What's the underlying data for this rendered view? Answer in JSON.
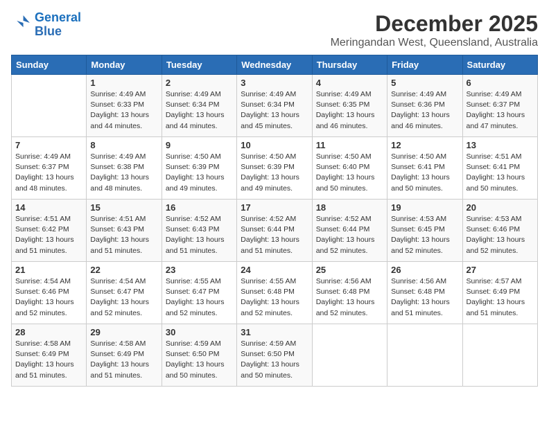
{
  "logo": {
    "line1": "General",
    "line2": "Blue"
  },
  "title": "December 2025",
  "location": "Meringandan West, Queensland, Australia",
  "weekdays": [
    "Sunday",
    "Monday",
    "Tuesday",
    "Wednesday",
    "Thursday",
    "Friday",
    "Saturday"
  ],
  "weeks": [
    [
      {
        "day": "",
        "detail": ""
      },
      {
        "day": "1",
        "detail": "Sunrise: 4:49 AM\nSunset: 6:33 PM\nDaylight: 13 hours\nand 44 minutes."
      },
      {
        "day": "2",
        "detail": "Sunrise: 4:49 AM\nSunset: 6:34 PM\nDaylight: 13 hours\nand 44 minutes."
      },
      {
        "day": "3",
        "detail": "Sunrise: 4:49 AM\nSunset: 6:34 PM\nDaylight: 13 hours\nand 45 minutes."
      },
      {
        "day": "4",
        "detail": "Sunrise: 4:49 AM\nSunset: 6:35 PM\nDaylight: 13 hours\nand 46 minutes."
      },
      {
        "day": "5",
        "detail": "Sunrise: 4:49 AM\nSunset: 6:36 PM\nDaylight: 13 hours\nand 46 minutes."
      },
      {
        "day": "6",
        "detail": "Sunrise: 4:49 AM\nSunset: 6:37 PM\nDaylight: 13 hours\nand 47 minutes."
      }
    ],
    [
      {
        "day": "7",
        "detail": "Sunrise: 4:49 AM\nSunset: 6:37 PM\nDaylight: 13 hours\nand 48 minutes."
      },
      {
        "day": "8",
        "detail": "Sunrise: 4:49 AM\nSunset: 6:38 PM\nDaylight: 13 hours\nand 48 minutes."
      },
      {
        "day": "9",
        "detail": "Sunrise: 4:50 AM\nSunset: 6:39 PM\nDaylight: 13 hours\nand 49 minutes."
      },
      {
        "day": "10",
        "detail": "Sunrise: 4:50 AM\nSunset: 6:39 PM\nDaylight: 13 hours\nand 49 minutes."
      },
      {
        "day": "11",
        "detail": "Sunrise: 4:50 AM\nSunset: 6:40 PM\nDaylight: 13 hours\nand 50 minutes."
      },
      {
        "day": "12",
        "detail": "Sunrise: 4:50 AM\nSunset: 6:41 PM\nDaylight: 13 hours\nand 50 minutes."
      },
      {
        "day": "13",
        "detail": "Sunrise: 4:51 AM\nSunset: 6:41 PM\nDaylight: 13 hours\nand 50 minutes."
      }
    ],
    [
      {
        "day": "14",
        "detail": "Sunrise: 4:51 AM\nSunset: 6:42 PM\nDaylight: 13 hours\nand 51 minutes."
      },
      {
        "day": "15",
        "detail": "Sunrise: 4:51 AM\nSunset: 6:43 PM\nDaylight: 13 hours\nand 51 minutes."
      },
      {
        "day": "16",
        "detail": "Sunrise: 4:52 AM\nSunset: 6:43 PM\nDaylight: 13 hours\nand 51 minutes."
      },
      {
        "day": "17",
        "detail": "Sunrise: 4:52 AM\nSunset: 6:44 PM\nDaylight: 13 hours\nand 51 minutes."
      },
      {
        "day": "18",
        "detail": "Sunrise: 4:52 AM\nSunset: 6:44 PM\nDaylight: 13 hours\nand 52 minutes."
      },
      {
        "day": "19",
        "detail": "Sunrise: 4:53 AM\nSunset: 6:45 PM\nDaylight: 13 hours\nand 52 minutes."
      },
      {
        "day": "20",
        "detail": "Sunrise: 4:53 AM\nSunset: 6:46 PM\nDaylight: 13 hours\nand 52 minutes."
      }
    ],
    [
      {
        "day": "21",
        "detail": "Sunrise: 4:54 AM\nSunset: 6:46 PM\nDaylight: 13 hours\nand 52 minutes."
      },
      {
        "day": "22",
        "detail": "Sunrise: 4:54 AM\nSunset: 6:47 PM\nDaylight: 13 hours\nand 52 minutes."
      },
      {
        "day": "23",
        "detail": "Sunrise: 4:55 AM\nSunset: 6:47 PM\nDaylight: 13 hours\nand 52 minutes."
      },
      {
        "day": "24",
        "detail": "Sunrise: 4:55 AM\nSunset: 6:48 PM\nDaylight: 13 hours\nand 52 minutes."
      },
      {
        "day": "25",
        "detail": "Sunrise: 4:56 AM\nSunset: 6:48 PM\nDaylight: 13 hours\nand 52 minutes."
      },
      {
        "day": "26",
        "detail": "Sunrise: 4:56 AM\nSunset: 6:48 PM\nDaylight: 13 hours\nand 51 minutes."
      },
      {
        "day": "27",
        "detail": "Sunrise: 4:57 AM\nSunset: 6:49 PM\nDaylight: 13 hours\nand 51 minutes."
      }
    ],
    [
      {
        "day": "28",
        "detail": "Sunrise: 4:58 AM\nSunset: 6:49 PM\nDaylight: 13 hours\nand 51 minutes."
      },
      {
        "day": "29",
        "detail": "Sunrise: 4:58 AM\nSunset: 6:49 PM\nDaylight: 13 hours\nand 51 minutes."
      },
      {
        "day": "30",
        "detail": "Sunrise: 4:59 AM\nSunset: 6:50 PM\nDaylight: 13 hours\nand 50 minutes."
      },
      {
        "day": "31",
        "detail": "Sunrise: 4:59 AM\nSunset: 6:50 PM\nDaylight: 13 hours\nand 50 minutes."
      },
      {
        "day": "",
        "detail": ""
      },
      {
        "day": "",
        "detail": ""
      },
      {
        "day": "",
        "detail": ""
      }
    ]
  ]
}
